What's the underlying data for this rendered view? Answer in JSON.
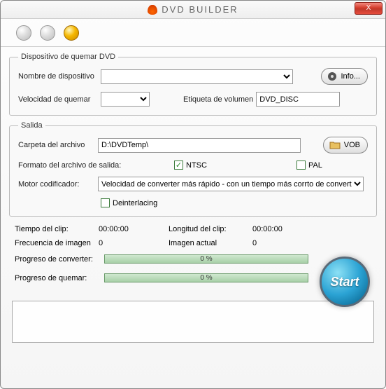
{
  "title": "DVD BUILDER",
  "close": "X",
  "device_group": {
    "legend": "Dispositivo de quemar DVD",
    "name_label": "Nombre de dispositivo",
    "name_value": "",
    "info_btn": "Info...",
    "speed_label": "Velocidad de quemar",
    "speed_value": "",
    "vol_label": "Etiqueta de volumen",
    "vol_value": "DVD_DISC"
  },
  "output_group": {
    "legend": "Salida",
    "folder_label": "Carpeta del archivo",
    "folder_value": "D:\\DVDTemp\\",
    "vob_btn": "VOB",
    "format_label": "Formato del archivo de salida:",
    "ntsc_label": "NTSC",
    "ntsc_checked": true,
    "pal_label": "PAL",
    "pal_checked": false,
    "encoder_label": "Motor codificador:",
    "encoder_value": "Velocidad de converter más rápido - con un tiempo más corrto de convertir",
    "deint_label": "Deinterlacing",
    "deint_checked": false
  },
  "stats": {
    "clip_time_label": "Tiempo del clip:",
    "clip_time_value": "00:00:00",
    "clip_len_label": "Longitud del clip:",
    "clip_len_value": "00:00:00",
    "fps_label": "Frecuencia de imagen",
    "fps_value": "0",
    "cur_label": "Imagen actual",
    "cur_value": "0"
  },
  "progress": {
    "conv_label": "Progreso de converter:",
    "conv_text": "0 %",
    "burn_label": "Progreso de quemar:",
    "burn_text": "0 %"
  },
  "start_btn": "Start"
}
